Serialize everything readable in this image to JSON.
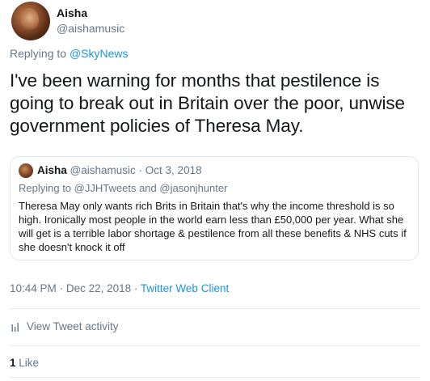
{
  "author": {
    "name": "Aisha",
    "handle": "@aishamusic"
  },
  "reply": {
    "prefix": "Replying to",
    "to": "@SkyNews"
  },
  "tweet_text": "I've been warning for months that pestilence is going to break out in Britain over the poor, unwise government policies of Theresa May.",
  "quoted": {
    "name": "Aisha",
    "handle": "@aishamusic",
    "separator": "·",
    "date": "Oct 3, 2018",
    "replying_prefix": "Replying to",
    "replying_to_1": "@JJHTweets",
    "replying_and": "and",
    "replying_to_2": "@jasonjhunter",
    "text": "Theresa May only wants rich Brits in Britain that's why the income threshold is so high. Ironically most people in the world earn less than £50,000 per year. What she will get is a terrible labor shortage & pestilence from all these benefits & NHS cuts if she doesn't knock it off"
  },
  "meta": {
    "time": "10:44 PM",
    "sep1": "·",
    "date": "Dec 22, 2018",
    "sep2": "·",
    "source": "Twitter Web Client"
  },
  "activity": {
    "label": "View Tweet activity",
    "icon": "analytics-icon"
  },
  "likes": {
    "count": "1",
    "label": "Like"
  },
  "colors": {
    "link": "#1b95e0",
    "secondary": "#657786",
    "primary": "#14171a",
    "border": "#e1e8ed"
  }
}
